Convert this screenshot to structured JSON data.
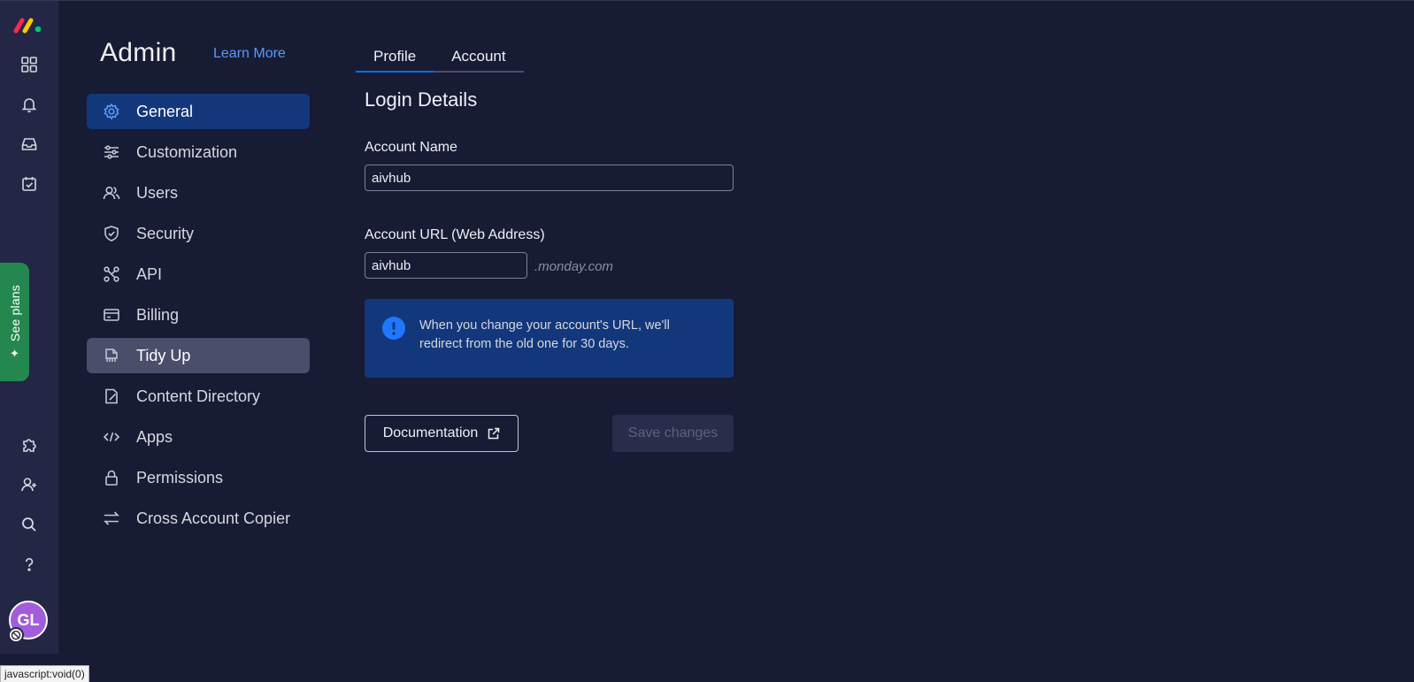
{
  "colors": {
    "background": "#181b34",
    "rail": "#232745",
    "accent": "#0073ea",
    "active_nav": "#13377b",
    "link": "#579bfc",
    "see_plans": "#258750",
    "avatar": "#a25ddc"
  },
  "rail": {
    "logo": "monday-logo",
    "top_items": [
      {
        "icon": "grid-icon"
      },
      {
        "icon": "bell-icon"
      },
      {
        "icon": "inbox-icon"
      },
      {
        "icon": "calendar-check-icon"
      }
    ],
    "see_plans": "See plans",
    "bottom_items": [
      {
        "icon": "puzzle-icon"
      },
      {
        "icon": "add-user-icon"
      },
      {
        "icon": "search-icon"
      },
      {
        "icon": "help-icon"
      }
    ],
    "avatar_initials": "GL"
  },
  "admin": {
    "title": "Admin",
    "learn_more": "Learn More",
    "nav": [
      {
        "label": "General",
        "icon": "gear-icon"
      },
      {
        "label": "Customization",
        "icon": "sliders-icon"
      },
      {
        "label": "Users",
        "icon": "users-icon"
      },
      {
        "label": "Security",
        "icon": "shield-icon"
      },
      {
        "label": "API",
        "icon": "api-icon"
      },
      {
        "label": "Billing",
        "icon": "credit-card-icon"
      },
      {
        "label": "Tidy Up",
        "icon": "tidy-up-icon"
      },
      {
        "label": "Content Directory",
        "icon": "content-directory-icon"
      },
      {
        "label": "Apps",
        "icon": "code-icon"
      },
      {
        "label": "Permissions",
        "icon": "lock-icon"
      },
      {
        "label": "Cross Account Copier",
        "icon": "swap-arrows-icon"
      }
    ],
    "active_item": "General",
    "hover_item": "Tidy Up"
  },
  "main": {
    "tabs": [
      {
        "label": "Profile"
      },
      {
        "label": "Account"
      }
    ],
    "active_tab": "Profile",
    "section_title": "Login Details",
    "account_name_label": "Account Name",
    "account_name_value": "aivhub",
    "account_url_label": "Account URL (Web Address)",
    "account_url_value": "aivhub",
    "url_suffix": ".monday.com",
    "info_text": "When you change your account's URL, we'll redirect from the old one for 30 days.",
    "documentation_label": "Documentation",
    "save_label": "Save changes"
  },
  "status_bar": "javascript:void(0)"
}
